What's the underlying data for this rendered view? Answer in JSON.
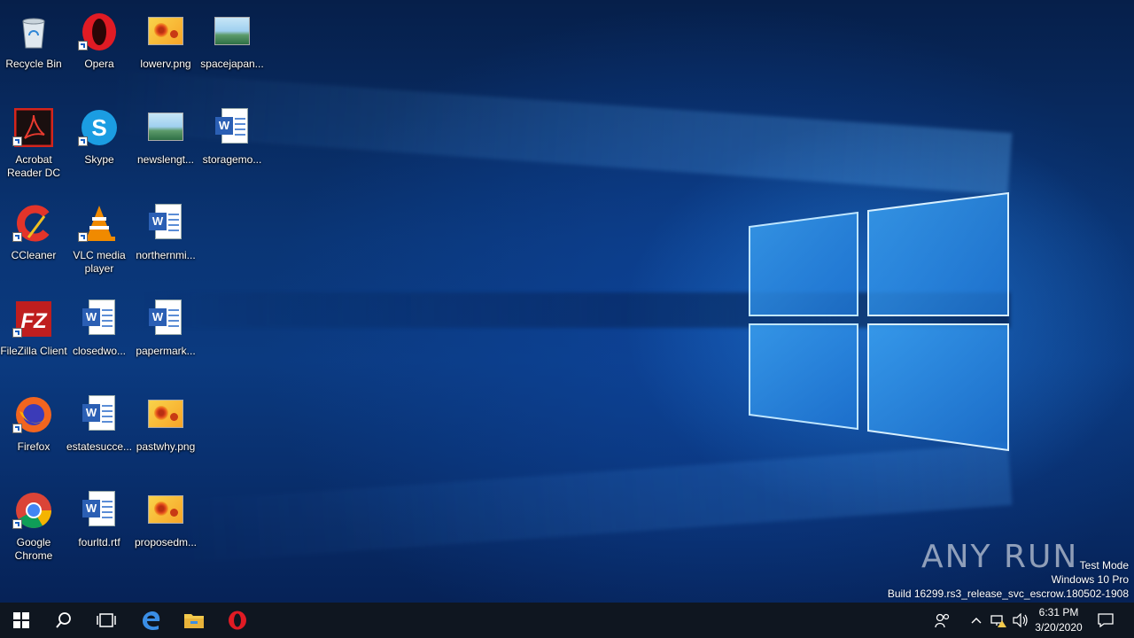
{
  "desktop": {
    "icons": [
      {
        "label": "Recycle Bin",
        "icon": "recycle-bin-icon"
      },
      {
        "label": "Opera",
        "icon": "opera-icon"
      },
      {
        "label": "lowerv.png",
        "icon": "image-file-icon"
      },
      {
        "label": "spacejapan...",
        "icon": "image-file-icon"
      },
      {
        "label": "Acrobat Reader DC",
        "icon": "acrobat-reader-icon"
      },
      {
        "label": "Skype",
        "icon": "skype-icon"
      },
      {
        "label": "newslengt...",
        "icon": "image-file-icon"
      },
      {
        "label": "storagemo...",
        "icon": "word-document-icon"
      },
      {
        "label": "CCleaner",
        "icon": "ccleaner-icon"
      },
      {
        "label": "VLC media player",
        "icon": "vlc-icon"
      },
      {
        "label": "northernmi...",
        "icon": "word-document-icon"
      },
      {
        "label": "FileZilla Client",
        "icon": "filezilla-icon"
      },
      {
        "label": "closedwo...",
        "icon": "word-document-icon"
      },
      {
        "label": "papermark...",
        "icon": "word-document-icon"
      },
      {
        "label": "Firefox",
        "icon": "firefox-icon"
      },
      {
        "label": "estatesucce...",
        "icon": "word-document-icon"
      },
      {
        "label": "pastwhy.png",
        "icon": "image-file-icon"
      },
      {
        "label": "Google Chrome",
        "icon": "chrome-icon"
      },
      {
        "label": "fourltd.rtf",
        "icon": "word-document-icon"
      },
      {
        "label": "proposedm...",
        "icon": "image-file-icon"
      }
    ]
  },
  "watermark": {
    "line1": "Test Mode",
    "line2": "Windows 10 Pro",
    "line3": "Build 16299.rs3_release_svc_escrow.180502-1908",
    "brand": "ANY RUN"
  },
  "taskbar": {
    "pinned": [
      "windows-start-icon",
      "search-icon",
      "task-view-icon",
      "edge-icon",
      "file-explorer-icon",
      "opera-icon"
    ],
    "time": "6:31 PM",
    "date": "3/20/2020"
  },
  "colors": {
    "taskbar": "#0f1620",
    "accent": "#2b5fb4"
  }
}
